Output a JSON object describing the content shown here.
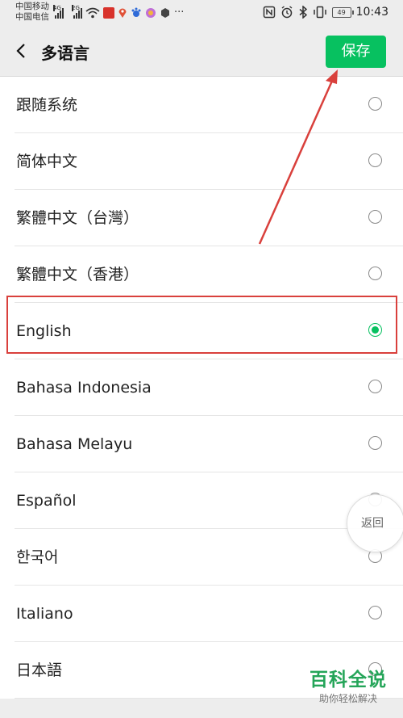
{
  "status_bar": {
    "carrier1": "中国移动",
    "carrier2": "中国电信",
    "net1": "4G",
    "net2": "2G",
    "battery": "49",
    "time": "10:43"
  },
  "header": {
    "title": "多语言",
    "save_label": "保存"
  },
  "languages": [
    {
      "label": "跟随系统",
      "selected": false
    },
    {
      "label": "简体中文",
      "selected": false
    },
    {
      "label": "繁體中文（台灣）",
      "selected": false
    },
    {
      "label": "繁體中文（香港）",
      "selected": false
    },
    {
      "label": "English",
      "selected": true
    },
    {
      "label": "Bahasa Indonesia",
      "selected": false
    },
    {
      "label": "Bahasa Melayu",
      "selected": false
    },
    {
      "label": "Español",
      "selected": false
    },
    {
      "label": "한국어",
      "selected": false
    },
    {
      "label": "Italiano",
      "selected": false
    },
    {
      "label": "日本語",
      "selected": false
    }
  ],
  "floating": {
    "back_label": "返回"
  },
  "watermark": {
    "brand": "百科全说",
    "slogan": "助你轻松解决"
  },
  "colors": {
    "accent": "#07c160",
    "annotation": "#d9403c",
    "brand": "#25a559"
  }
}
